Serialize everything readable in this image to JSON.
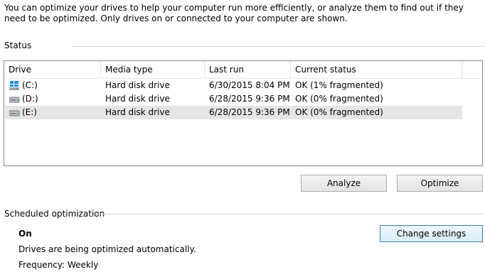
{
  "intro_text": "You can optimize your drives to help your computer run more efficiently, or analyze them to find out if they need to be optimized. Only drives on or connected to your computer are shown.",
  "status_section": {
    "label": "Status"
  },
  "drive_table": {
    "headers": {
      "drive": "Drive",
      "media_type": "Media type",
      "last_run": "Last run",
      "current_status": "Current status"
    },
    "rows": [
      {
        "drive": "(C:)",
        "icon": "windows-system-drive-icon",
        "media_type": "Hard disk drive",
        "last_run": "6/30/2015 8:04 PM",
        "current_status": "OK (1% fragmented)",
        "selected": false
      },
      {
        "drive": "(D:)",
        "icon": "hard-drive-icon",
        "media_type": "Hard disk drive",
        "last_run": "6/28/2015 9:36 PM",
        "current_status": "OK (0% fragmented)",
        "selected": false
      },
      {
        "drive": "(E:)",
        "icon": "hard-drive-icon",
        "media_type": "Hard disk drive",
        "last_run": "6/28/2015 9:36 PM",
        "current_status": "OK (0% fragmented)",
        "selected": true
      }
    ]
  },
  "buttons": {
    "analyze": "Analyze",
    "optimize": "Optimize",
    "change_settings": "Change settings"
  },
  "scheduled_section": {
    "label": "Scheduled optimization",
    "state": "On",
    "description": "Drives are being optimized automatically.",
    "frequency": "Frequency: Weekly"
  }
}
